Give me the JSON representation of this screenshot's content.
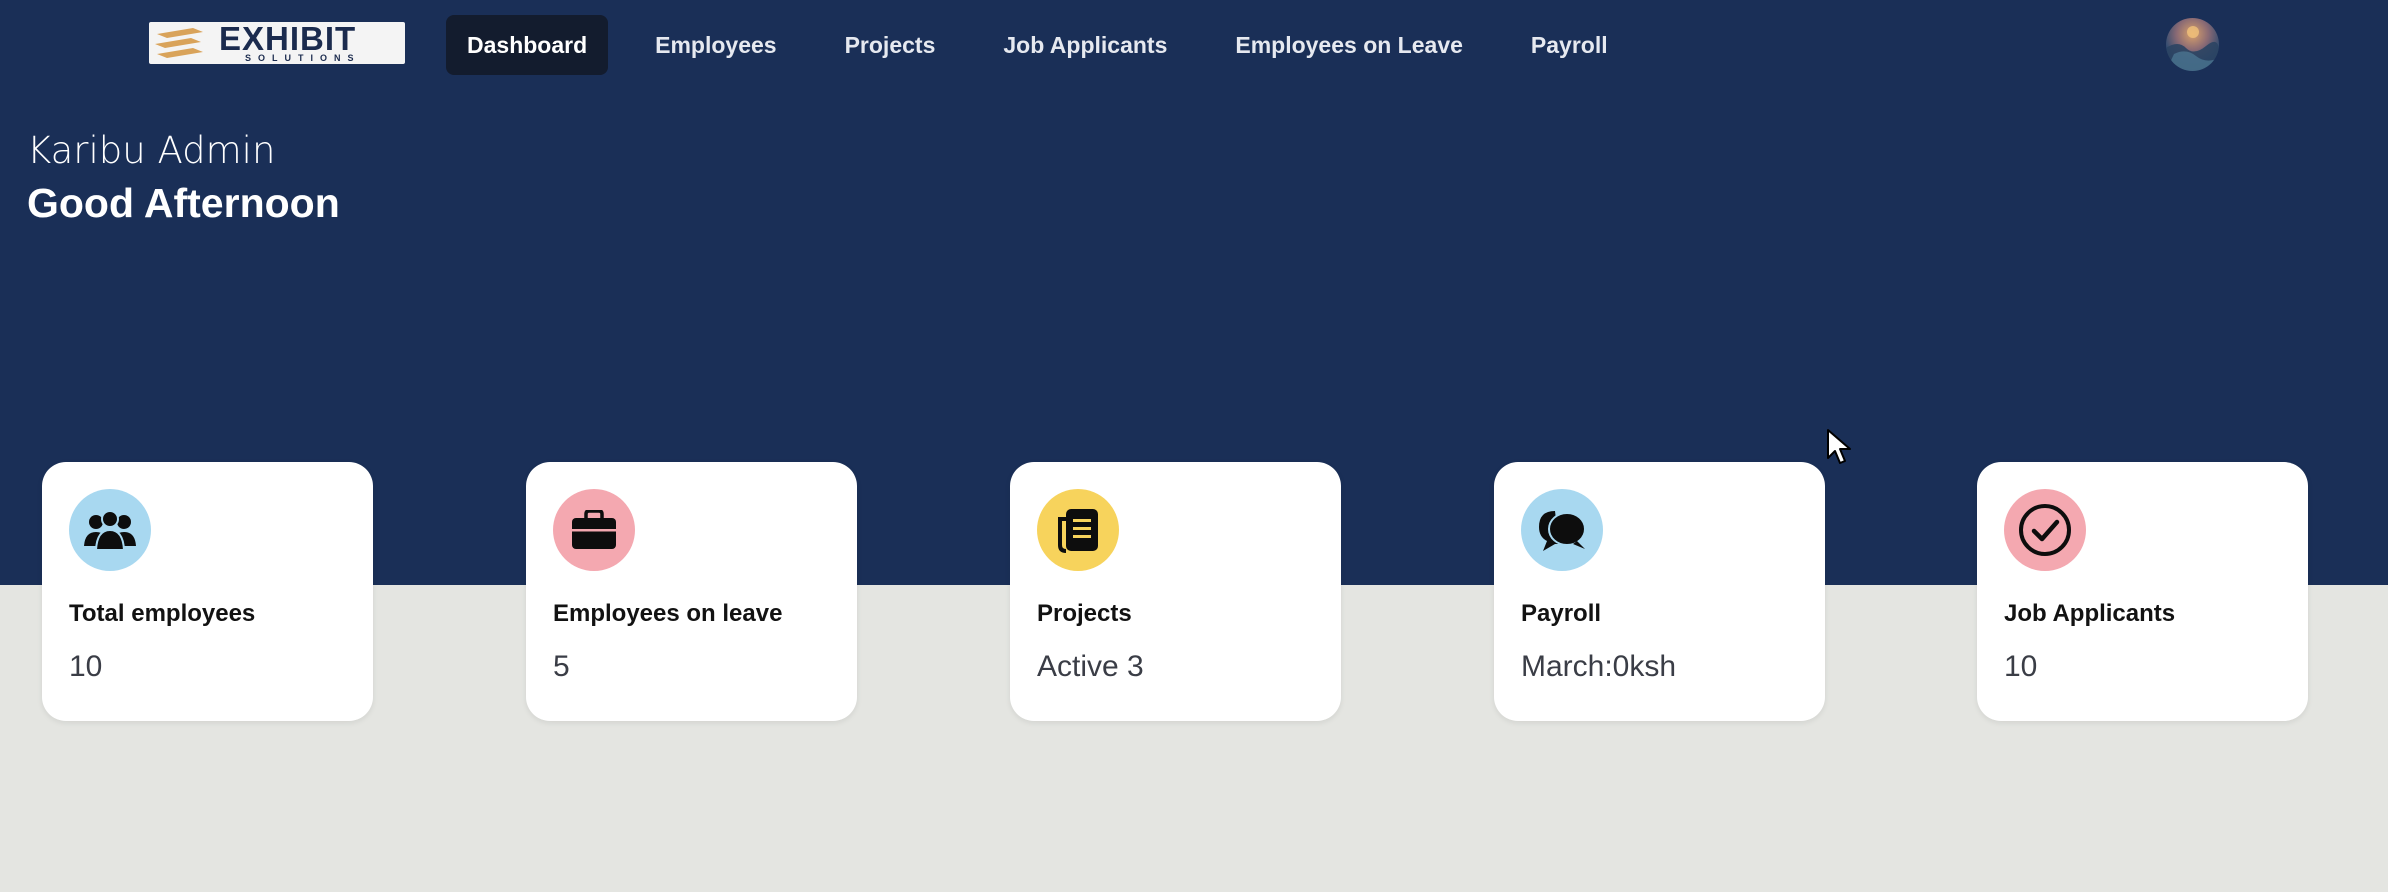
{
  "brand": {
    "name": "EXHIBIT",
    "tagline": "SOLUTIONS"
  },
  "nav": {
    "items": [
      {
        "label": "Dashboard",
        "active": true
      },
      {
        "label": "Employees"
      },
      {
        "label": "Projects"
      },
      {
        "label": "Job Applicants"
      },
      {
        "label": "Employees on Leave"
      },
      {
        "label": "Payroll"
      }
    ]
  },
  "greeting": {
    "welcome": "Karibu Admin",
    "salutation": "Good Afternoon"
  },
  "cards": [
    {
      "title": "Total employees",
      "value": "10",
      "icon": "users-icon",
      "icon_bg": "#a8d8f0"
    },
    {
      "title": "Employees on leave",
      "value": "5",
      "icon": "briefcase-icon",
      "icon_bg": "#f4a8b0"
    },
    {
      "title": "Projects",
      "value": "Active 3",
      "icon": "document-icon",
      "icon_bg": "#f7d35c"
    },
    {
      "title": "Payroll",
      "value": "March:0ksh",
      "icon": "chat-icon",
      "icon_bg": "#a8d8f0"
    },
    {
      "title": "Job Applicants",
      "value": "10",
      "icon": "check-circle-icon",
      "icon_bg": "#f4a8b0"
    }
  ],
  "colors": {
    "hero": "#1a2f57",
    "page": "#e4e5e1",
    "nav_active": "#131c2e"
  }
}
